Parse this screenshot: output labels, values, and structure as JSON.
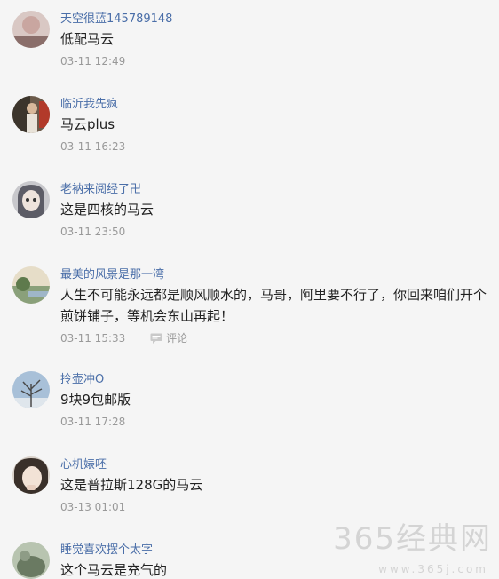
{
  "comments": [
    {
      "username": "天空很蓝145789148",
      "text": "低配马云",
      "time": "03-11 12:49"
    },
    {
      "username": "临沂我先疯",
      "text": "马云plus",
      "time": "03-11 16:23"
    },
    {
      "username": "老衲来阅经了卍",
      "text": "这是四核的马云",
      "time": "03-11 23:50"
    },
    {
      "username": "最美的风景是那一湾",
      "text": "人生不可能永远都是顺风顺水的，马哥，阿里要不行了，你回来咱们开个煎饼铺子，等机会东山再起！",
      "time": "03-11 15:33",
      "reply_label": "评论"
    },
    {
      "username": "拎壶冲O",
      "text": "9块9包邮版",
      "time": "03-11 17:28"
    },
    {
      "username": "心机婊呸",
      "text": "这是普拉斯128G的马云",
      "time": "03-13 01:01"
    },
    {
      "username": "睡觉喜欢摆个太字",
      "text": "这个马云是充气的",
      "time": ""
    }
  ],
  "watermark": {
    "text": "365经典网",
    "url": "www.365j.com"
  },
  "colors": {
    "username": "#4a6ea8",
    "time": "#999999",
    "text": "#222222",
    "background": "#f5f5f5"
  }
}
